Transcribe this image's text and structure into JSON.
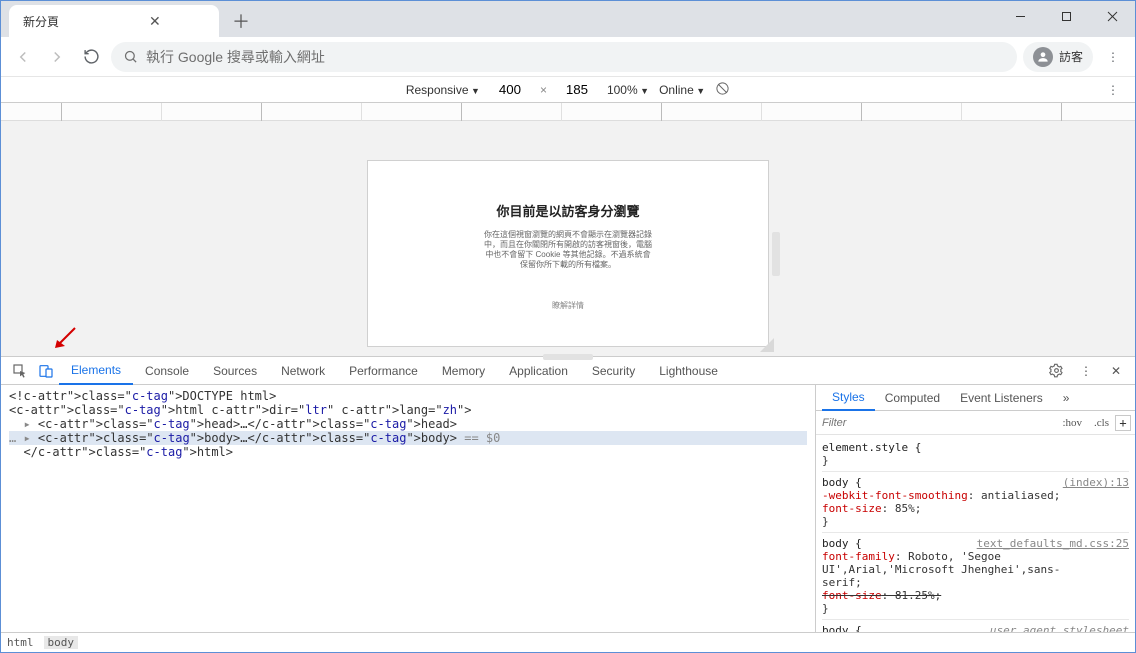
{
  "window": {
    "tab_title": "新分頁"
  },
  "toolbar": {
    "omnibox_placeholder": "執行 Google 搜尋或輸入網址",
    "avatar_label": "訪客"
  },
  "device_toolbar": {
    "mode": "Responsive",
    "width": "400",
    "height": "185",
    "zoom": "100%",
    "throttling": "Online"
  },
  "frame": {
    "heading": "你目前是以訪客身分瀏覽",
    "paragraph": "你在這個視窗瀏覽的網頁不會顯示在瀏覽器記錄中，而且在你關閉所有開啟的訪客視窗後，電腦中也不會留下 Cookie 等其他記錄。不過系統會保留你所下載的所有檔案。",
    "link": "瞭解詳情"
  },
  "devtools": {
    "tabs": [
      "Elements",
      "Console",
      "Sources",
      "Network",
      "Performance",
      "Memory",
      "Application",
      "Security",
      "Lighthouse"
    ],
    "active_tab": 0,
    "dom_lines": [
      {
        "text": "<!DOCTYPE html>",
        "kind": "doctype"
      },
      {
        "text": "<html dir=\"ltr\" lang=\"zh\">",
        "kind": "open"
      },
      {
        "text": "  ▸ <head>…</head>",
        "kind": "node"
      },
      {
        "text": "… ▸ <body>…</body> == $0",
        "kind": "selected"
      },
      {
        "text": "  </html>",
        "kind": "close"
      }
    ],
    "styles": {
      "tabs": [
        "Styles",
        "Computed",
        "Event Listeners"
      ],
      "active": 0,
      "filter_placeholder": "Filter",
      "hov": ":hov",
      "cls": ".cls",
      "rules": [
        {
          "selector": "element.style {",
          "src": "",
          "lines": [],
          "close": "}"
        },
        {
          "selector": "body {",
          "src": "(index):13",
          "lines": [
            "  -webkit-font-smoothing: antialiased;",
            "  font-size: 85%;"
          ],
          "close": "}"
        },
        {
          "selector": "body {",
          "src": "text_defaults_md.css:25",
          "lines": [
            "  font-family: Roboto, 'Segoe",
            "      UI',Arial,'Microsoft Jhenghei',sans-",
            "      serif;",
            "  ~~font-size: 81.25%;~~"
          ],
          "close": "}"
        },
        {
          "selector": "body {",
          "src": "user agent stylesheet",
          "lines": [],
          "close": ""
        }
      ]
    },
    "breadcrumb": [
      "html",
      "body"
    ]
  }
}
